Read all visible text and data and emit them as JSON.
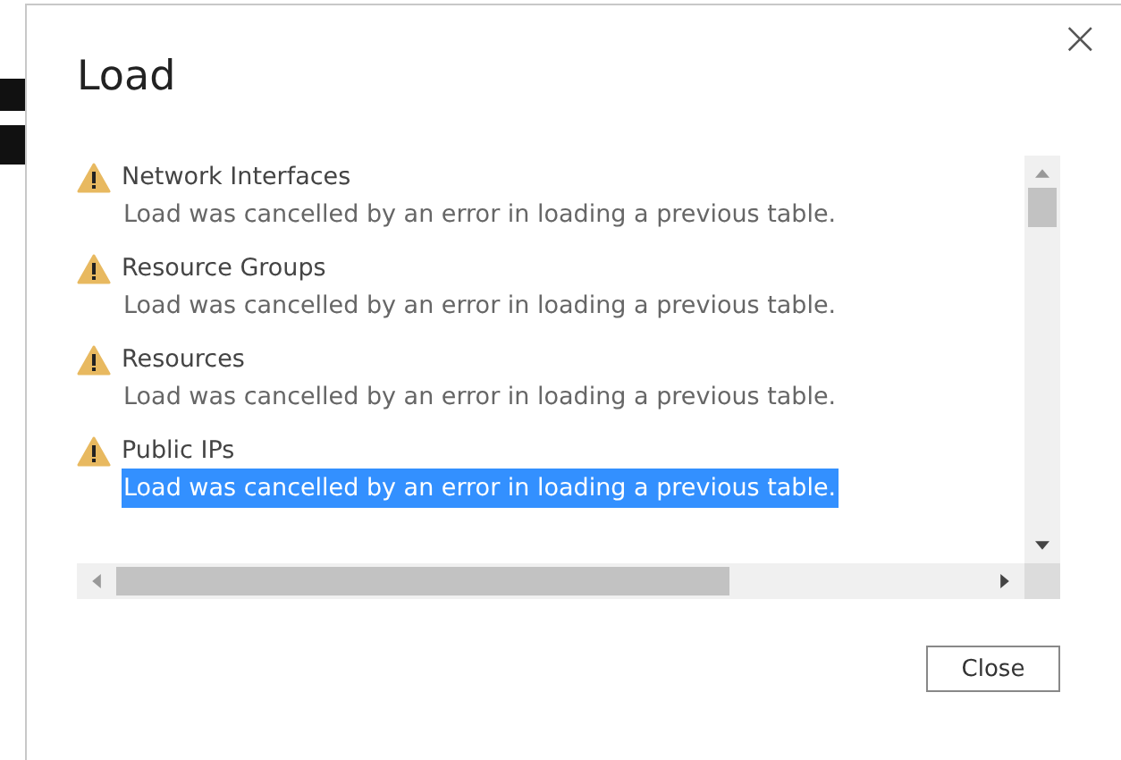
{
  "dialog": {
    "title": "Load",
    "close_icon": "×"
  },
  "items": [
    {
      "name": "Network Interfaces",
      "message": "Load was cancelled by an error in loading a previous table.",
      "selected": false
    },
    {
      "name": "Resource Groups",
      "message": "Load was cancelled by an error in loading a previous table.",
      "selected": false
    },
    {
      "name": "Resources",
      "message": "Load was cancelled by an error in loading a previous table.",
      "selected": false
    },
    {
      "name": "Public IPs",
      "message": "Load was cancelled by an error in loading a previous table.",
      "selected": true
    }
  ],
  "buttons": [
    "Close"
  ]
}
